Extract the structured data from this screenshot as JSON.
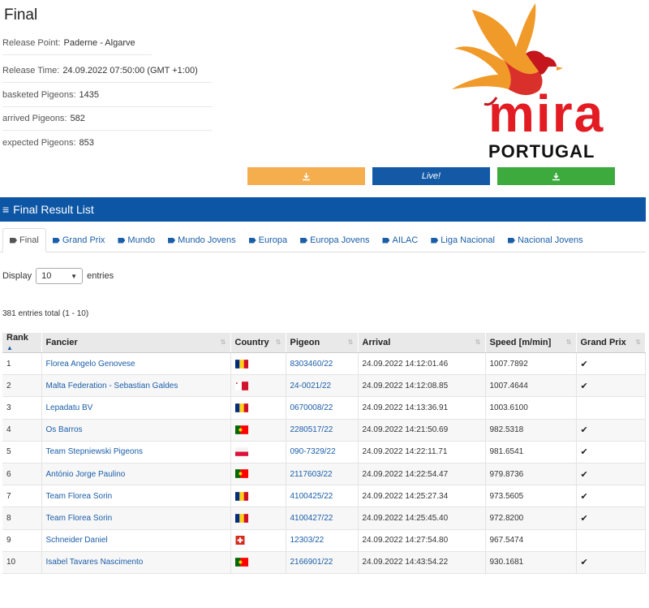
{
  "page": {
    "title": "Final",
    "release_point_label": "Release Point:",
    "release_point": "Paderne - Algarve",
    "release_time_label": "Release Time:",
    "release_time": "24.09.2022 07:50:00 (GMT +1:00)",
    "basketed_label": "basketed Pigeons:",
    "basketed": "1435",
    "arrived_label": "arrived Pigeons:",
    "arrived": "582",
    "expected_label": "expected Pigeons:",
    "expected": "853"
  },
  "logo": {
    "brand": "mira",
    "country": "PORTUGAL",
    "bird_color": "#f09a2a",
    "text_color": "#e31b23"
  },
  "buttons": {
    "download_icon": "download-icon",
    "live_label": "Live!",
    "orange": "#f5ae4e",
    "blue": "#1359a6",
    "green": "#3caa3c"
  },
  "section": {
    "title": "Final Result List",
    "icon": "list-icon"
  },
  "tabs": [
    "Final",
    "Grand Prix",
    "Mundo",
    "Mundo Jovens",
    "Europa",
    "Europa Jovens",
    "AILAC",
    "Liga Nacional",
    "Nacional Jovens"
  ],
  "display": {
    "label": "Display",
    "value": "10",
    "suffix": "entries"
  },
  "total": "381 entries total (1 - 10)",
  "table": {
    "headers": [
      "Rank",
      "Fancier",
      "Country",
      "Pigeon",
      "Arrival",
      "Speed [m/min]",
      "Grand Prix"
    ],
    "rows": [
      {
        "rank": "1",
        "fancier": "Florea Angelo Genovese",
        "country": "ro",
        "pigeon": "8303460/22",
        "arrival": "24.09.2022 14:12:01.46",
        "speed": "1007.7892",
        "gp": "✔"
      },
      {
        "rank": "2",
        "fancier": "Malta Federation - Sebastian Galdes",
        "country": "mt",
        "pigeon": "24-0021/22",
        "arrival": "24.09.2022 14:12:08.85",
        "speed": "1007.4644",
        "gp": "✔"
      },
      {
        "rank": "3",
        "fancier": "Lepadatu BV",
        "country": "ro",
        "pigeon": "0670008/22",
        "arrival": "24.09.2022 14:13:36.91",
        "speed": "1003.6100",
        "gp": ""
      },
      {
        "rank": "4",
        "fancier": "Os Barros",
        "country": "pt",
        "pigeon": "2280517/22",
        "arrival": "24.09.2022 14:21:50.69",
        "speed": "982.5318",
        "gp": "✔"
      },
      {
        "rank": "5",
        "fancier": "Team Stepniewski Pigeons",
        "country": "pl",
        "pigeon": "090-7329/22",
        "arrival": "24.09.2022 14:22:11.71",
        "speed": "981.6541",
        "gp": "✔"
      },
      {
        "rank": "6",
        "fancier": "António Jorge Paulino",
        "country": "pt",
        "pigeon": "2117603/22",
        "arrival": "24.09.2022 14:22:54.47",
        "speed": "979.8736",
        "gp": "✔"
      },
      {
        "rank": "7",
        "fancier": "Team Florea Sorin",
        "country": "ro",
        "pigeon": "4100425/22",
        "arrival": "24.09.2022 14:25:27.34",
        "speed": "973.5605",
        "gp": "✔"
      },
      {
        "rank": "8",
        "fancier": "Team Florea Sorin",
        "country": "ro",
        "pigeon": "4100427/22",
        "arrival": "24.09.2022 14:25:45.40",
        "speed": "972.8200",
        "gp": "✔"
      },
      {
        "rank": "9",
        "fancier": "Schneider Daniel",
        "country": "ch",
        "pigeon": "12303/22",
        "arrival": "24.09.2022 14:27:54.80",
        "speed": "967.5474",
        "gp": ""
      },
      {
        "rank": "10",
        "fancier": "Isabel Tavares Nascimento",
        "country": "pt",
        "pigeon": "2166901/22",
        "arrival": "24.09.2022 14:43:54.22",
        "speed": "930.1681",
        "gp": "✔"
      }
    ]
  }
}
